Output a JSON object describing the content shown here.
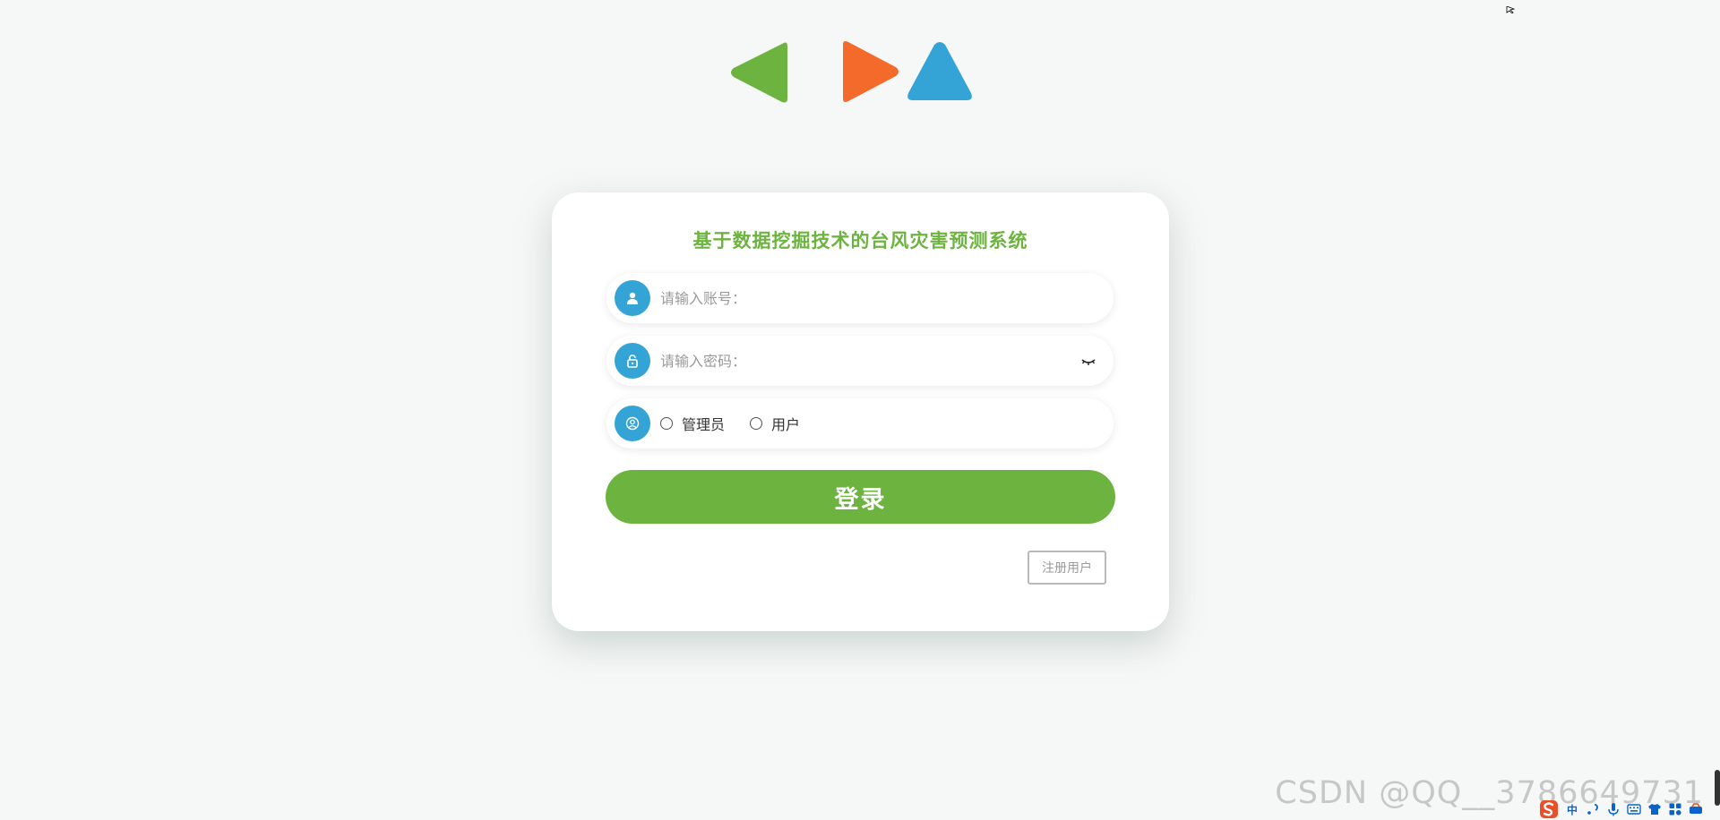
{
  "system_title": "基于数据挖掘技术的台风灾害预测系统",
  "username": {
    "placeholder": "请输入账号：",
    "value": "",
    "icon": "user-icon"
  },
  "password": {
    "placeholder": "请输入密码：",
    "value": "",
    "icon": "lock-icon",
    "toggle_icon": "eye-closed-icon"
  },
  "role": {
    "icon": "user-circle-icon",
    "options": [
      "管理员",
      "用户"
    ],
    "selected": null
  },
  "login_label": "登录",
  "register_label": "注册用户",
  "watermark": "CSDN @QQ__3786649731",
  "tray": {
    "ime_label": "中",
    "icons": [
      "sogou-logo-icon",
      "ime-chinese-icon",
      "punctuation-icon",
      "microphone-icon",
      "keyboard-icon",
      "skin-icon",
      "apps-icon",
      "tools-icon"
    ]
  },
  "colors": {
    "accent_green": "#6db33f",
    "field_icon_blue": "#34a3d6",
    "logo_green": "#6db33f",
    "logo_orange": "#f46a2b",
    "logo_blue": "#34a3d6"
  }
}
